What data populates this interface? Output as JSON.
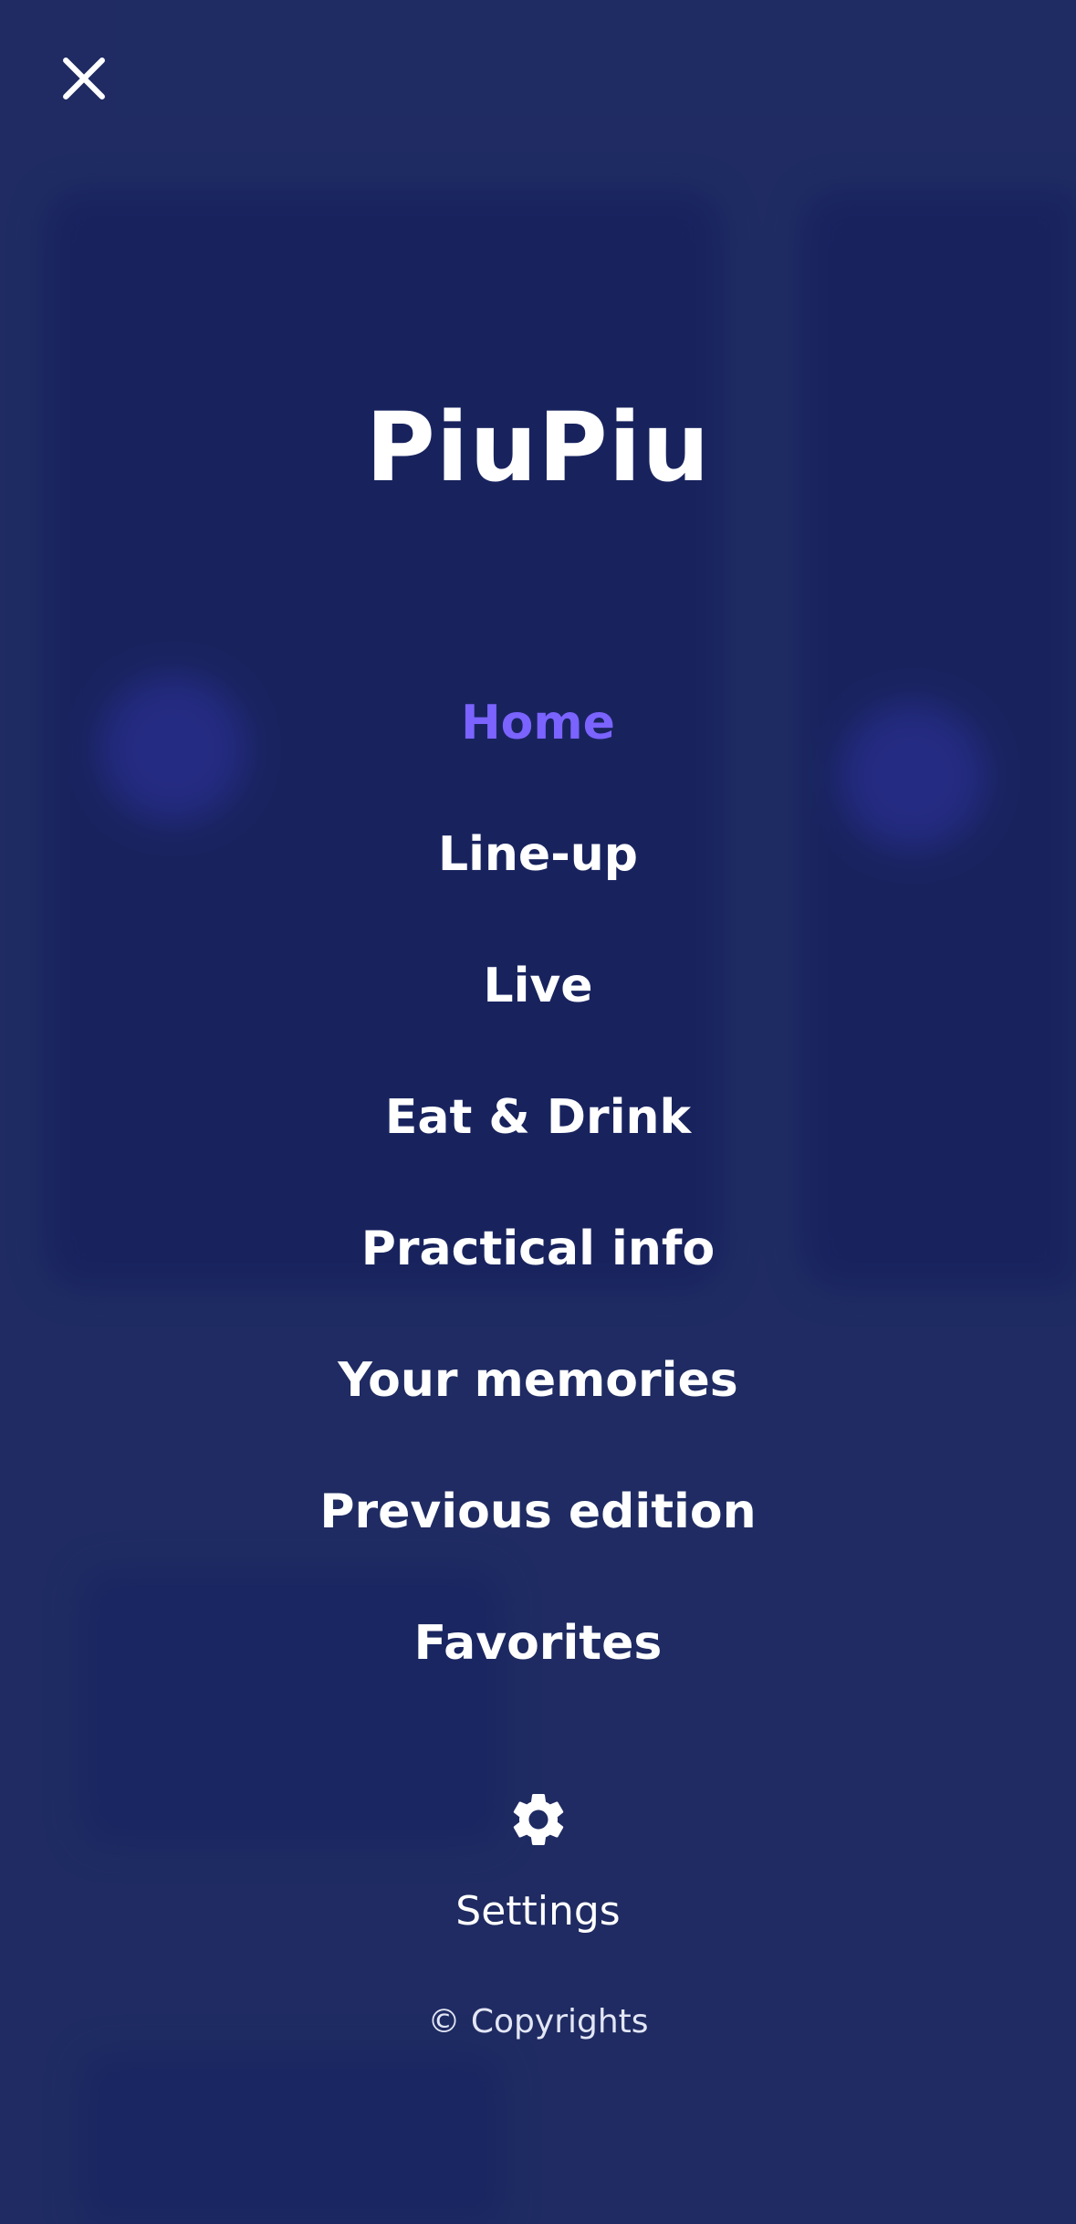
{
  "header": {
    "close_icon": "close-icon"
  },
  "brand": {
    "title": "PiuPiu"
  },
  "menu": {
    "items": [
      {
        "label": "Home",
        "active": true
      },
      {
        "label": "Line-up",
        "active": false
      },
      {
        "label": "Live",
        "active": false
      },
      {
        "label": "Eat & Drink",
        "active": false
      },
      {
        "label": "Practical info",
        "active": false
      },
      {
        "label": "Your memories",
        "active": false
      },
      {
        "label": "Previous edition",
        "active": false
      },
      {
        "label": "Favorites",
        "active": false
      }
    ]
  },
  "settings": {
    "icon": "gear-icon",
    "label": "Settings"
  },
  "footer": {
    "copyright": "© Copyrights"
  },
  "colors": {
    "background": "#1f2b63",
    "active": "#7b63ff",
    "text": "#ffffff"
  }
}
